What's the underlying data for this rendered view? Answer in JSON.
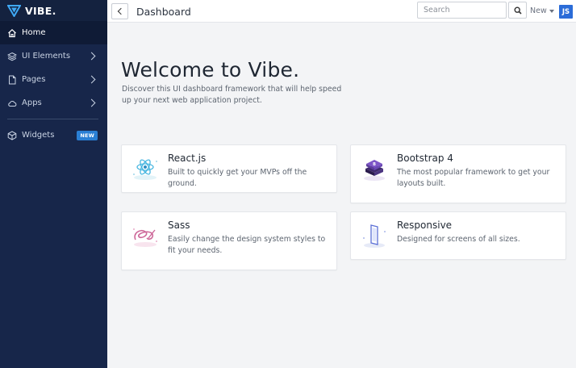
{
  "brand": {
    "name": "VIBE."
  },
  "sidebar": {
    "items": [
      {
        "label": "Home",
        "icon": "home-icon",
        "active": true
      },
      {
        "label": "UI Elements",
        "icon": "layers-icon"
      },
      {
        "label": "Pages",
        "icon": "file-icon"
      },
      {
        "label": "Apps",
        "icon": "cloud-icon"
      },
      {
        "label": "Widgets",
        "icon": "box-icon",
        "badge": "NEW"
      }
    ]
  },
  "header": {
    "title": "Dashboard",
    "search_placeholder": "Search",
    "new_label": "New",
    "avatar_initials": "JS"
  },
  "main": {
    "welcome": "Welcome to Vibe.",
    "subtitle": "Discover this UI dashboard framework that will help speed up your next web application project."
  },
  "cards": [
    {
      "title": "React.js",
      "description": "Built to quickly get your MVPs off the ground.",
      "icon": "react-icon"
    },
    {
      "title": "Bootstrap 4",
      "description": "The most popular framework to get your layouts built.",
      "icon": "bootstrap-icon"
    },
    {
      "title": "Sass",
      "description": "Easily change the design system styles to fit your needs.",
      "icon": "sass-icon"
    },
    {
      "title": "Responsive",
      "description": "Designed for screens of all sizes.",
      "icon": "responsive-icon"
    }
  ],
  "colors": {
    "sidebar_bg": "#17264a",
    "active_item_bg": "#0f1b36",
    "accent": "#2a7fd4",
    "avatar_bg": "#2b6cd8"
  }
}
